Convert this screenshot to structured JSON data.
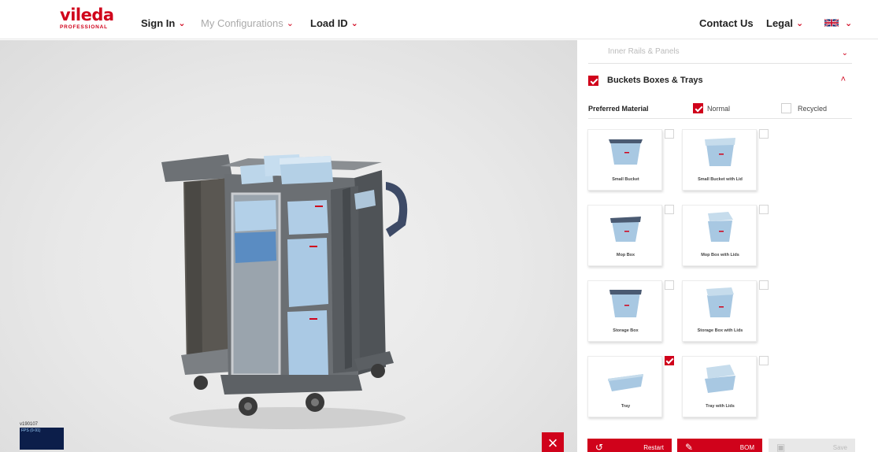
{
  "header": {
    "brand": "vileda",
    "brand_sub": "PROFESSIONAL",
    "nav": [
      {
        "label": "Sign In",
        "enabled": true
      },
      {
        "label": "My Configurations",
        "enabled": false
      },
      {
        "label": "Load ID",
        "enabled": true
      }
    ],
    "contact": "Contact Us",
    "legal": "Legal",
    "language_icon": "uk-flag-icon"
  },
  "viewer": {
    "version": "v190107",
    "fps": "FPS (0-91)",
    "close_icon": "close-icon"
  },
  "panel": {
    "inner_rails_label": "Inner Rails & Panels",
    "buckets_label": "Buckets Boxes & Trays",
    "buckets_checked": true,
    "preferred_material_label": "Preferred Material",
    "material_normal": "Normal",
    "material_recycled": "Recycled",
    "normal_checked": true,
    "recycled_checked": false,
    "items": [
      {
        "label": "Small Bucket",
        "checked": false
      },
      {
        "label": "Small Bucket with Lid",
        "checked": false
      },
      {
        "label": "Mop Box",
        "checked": false
      },
      {
        "label": "Mop Box with Lids",
        "checked": false
      },
      {
        "label": "Storage Box",
        "checked": false
      },
      {
        "label": "Storage Box with Lids",
        "checked": false
      },
      {
        "label": "Tray",
        "checked": true
      },
      {
        "label": "Tray with Lids",
        "checked": false
      }
    ],
    "buttons": {
      "restart": "Restart",
      "bom": "BOM",
      "save": "Save"
    }
  },
  "colors": {
    "accent": "#d0021b",
    "navy": "#0c1e4a"
  }
}
